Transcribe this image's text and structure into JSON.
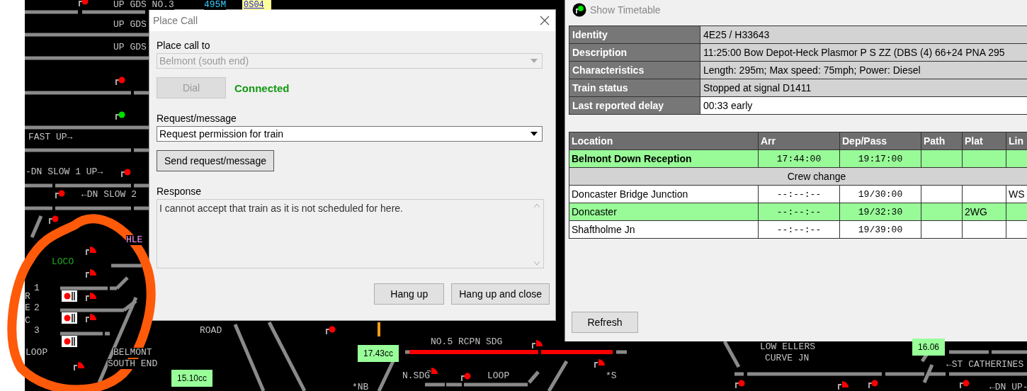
{
  "track_labels": [
    {
      "text": "UP GDS NO.3",
      "kind": "line"
    },
    {
      "text": "495M",
      "kind": "distance"
    },
    {
      "text": "0S04",
      "kind": "berth"
    },
    {
      "text": "UP GDS",
      "kind": "line"
    },
    {
      "text": "UP GDS",
      "kind": "line"
    },
    {
      "text": "FAST UP→",
      "kind": "line"
    },
    {
      "text": "-DN SLOW 1 UP→",
      "kind": "line"
    },
    {
      "text": "←DN SLOW 2",
      "kind": "line"
    },
    {
      "text": "HLE",
      "kind": "hle"
    },
    {
      "text": "LOCO",
      "kind": "loco"
    },
    {
      "text": "1",
      "kind": "line"
    },
    {
      "text": "2",
      "kind": "line"
    },
    {
      "text": "3",
      "kind": "line"
    },
    {
      "text": "R",
      "kind": "line"
    },
    {
      "text": "E",
      "kind": "line"
    },
    {
      "text": "C",
      "kind": "line"
    },
    {
      "text": "LOOP",
      "kind": "line"
    },
    {
      "text": "BELMONT",
      "kind": "line"
    },
    {
      "text": "SOUTH END",
      "kind": "line"
    },
    {
      "text": "ROAD",
      "kind": "line"
    },
    {
      "text": "NO.5 RCPN SDG",
      "kind": "line"
    },
    {
      "text": "N.SDG",
      "kind": "line"
    },
    {
      "text": "LOOP",
      "kind": "line"
    },
    {
      "text": "*NB",
      "kind": "line"
    },
    {
      "text": "*S",
      "kind": "line"
    },
    {
      "text": "LOW ELLERS",
      "kind": "line"
    },
    {
      "text": "CURVE JN",
      "kind": "line"
    },
    {
      "text": "←ST CATHERINES",
      "kind": "line"
    },
    {
      "text": "←DN UP-",
      "kind": "line"
    },
    {
      "text": "17.43cc",
      "kind": "timer"
    },
    {
      "text": "15.10cc",
      "kind": "timer"
    },
    {
      "text": "16.06",
      "kind": "timer"
    }
  ],
  "signals": [
    {
      "kind": "main",
      "color": "#ff0000"
    },
    {
      "kind": "main",
      "color": "#ff0000"
    },
    {
      "kind": "main",
      "color": "#00e000"
    },
    {
      "kind": "main",
      "color": "#ff0000"
    },
    {
      "kind": "main",
      "color": "#ff0000"
    },
    {
      "kind": "main",
      "color": "#ff0000"
    },
    {
      "kind": "main",
      "color": "#ff0000"
    },
    {
      "kind": "main",
      "color": "#ff0000"
    },
    {
      "kind": "main",
      "color": "#ff0000"
    },
    {
      "kind": "main",
      "color": "#ff0000"
    },
    {
      "kind": "main",
      "color": "#ff0000"
    },
    {
      "kind": "shunt",
      "color": "#ff0000"
    },
    {
      "kind": "shunt",
      "color": "#ff0000"
    },
    {
      "kind": "shunt",
      "color": "#ff0000"
    },
    {
      "kind": "shunt",
      "color": "#ff0000"
    },
    {
      "kind": "shunt",
      "color": "#ff0000"
    },
    {
      "kind": "shunt",
      "color": "#ff0000"
    },
    {
      "kind": "shunt",
      "color": "#ff0000"
    },
    {
      "kind": "shunt",
      "color": "#ff0000"
    },
    {
      "kind": "shunt",
      "color": "#ff0000"
    },
    {
      "kind": "box",
      "color": "#ff0000"
    },
    {
      "kind": "box",
      "color": "#ff0000"
    },
    {
      "kind": "box",
      "color": "#ff0000"
    }
  ],
  "place_call": {
    "title": "Place Call",
    "call_to_label": "Place call to",
    "call_to": {
      "value": "Belmont (south end)",
      "disabled": true
    },
    "dial_button": {
      "label": "Dial",
      "disabled": true
    },
    "status": "Connected",
    "request_label": "Request/message",
    "request": {
      "value": "Request permission for train",
      "disabled": false
    },
    "send_button": "Send request/message",
    "response_label": "Response",
    "response": "I cannot accept that train as it is not scheduled for here.",
    "buttons": [
      "Hang up",
      "Hang up and close"
    ]
  },
  "timetable": {
    "title": "Show Timetable",
    "details": [
      {
        "label": "Identity",
        "value": "4E25 / H33643",
        "shaded": true
      },
      {
        "label": "Description",
        "value": "11:25:00 Bow Depot-Heck Plasmor P S ZZ (DBS (4) 66+24 PNA 295",
        "shaded": true
      },
      {
        "label": "Characteristics",
        "value": "Length: 295m; Max speed: 75mph; Power: Diesel",
        "shaded": true
      },
      {
        "label": "Train status",
        "value": "Stopped at signal D1411",
        "shaded": true
      },
      {
        "label": "Last reported delay",
        "value": "00:33 early",
        "shaded": false
      }
    ],
    "columns": [
      "Location",
      "Arr",
      "Dep/Pass",
      "Path",
      "Plat",
      "Lin"
    ],
    "rows": [
      {
        "kind": "stop",
        "current": true,
        "highlighted": true,
        "location": "Belmont Down Reception",
        "arr": "17:44:00",
        "dep": "19:17:00"
      },
      {
        "kind": "note",
        "text": "Crew change"
      },
      {
        "kind": "stop",
        "current": false,
        "highlighted": false,
        "location": "Doncaster Bridge Junction",
        "arr": "--:--:--",
        "dep": "19/30:00",
        "line": "WS"
      },
      {
        "kind": "stop",
        "current": false,
        "highlighted": true,
        "location": "Doncaster",
        "arr": "--:--:--",
        "dep": "19/32:30",
        "plat": "2WG"
      },
      {
        "kind": "stop",
        "current": false,
        "highlighted": false,
        "location": "Shaftholme Jn",
        "arr": "--:--:--",
        "dep": "19/39:00"
      }
    ],
    "refresh_button": "Refresh"
  }
}
